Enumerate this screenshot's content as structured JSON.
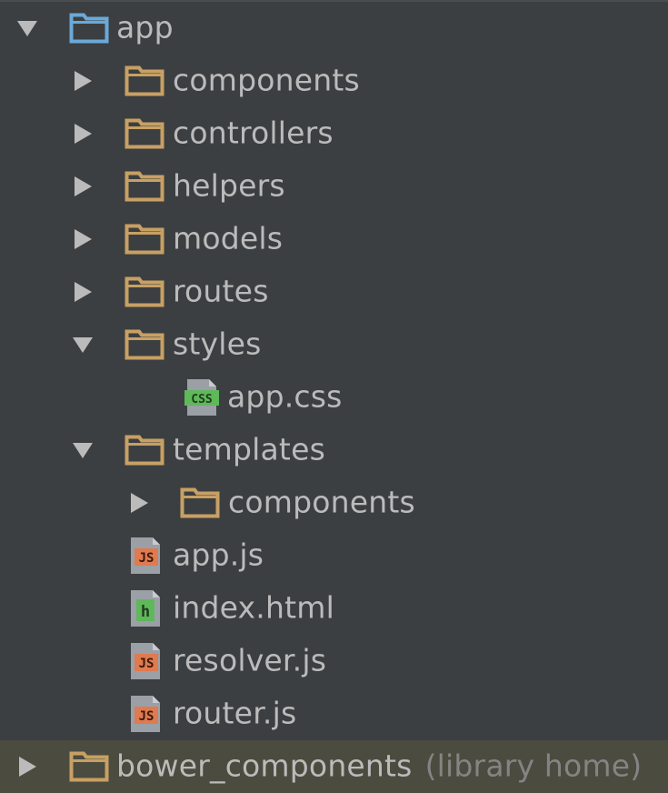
{
  "tree": {
    "root": {
      "label": "app"
    },
    "app_children": [
      {
        "label": "components"
      },
      {
        "label": "controllers"
      },
      {
        "label": "helpers"
      },
      {
        "label": "models"
      },
      {
        "label": "routes"
      },
      {
        "label": "styles"
      }
    ],
    "styles_children": [
      {
        "label": "app.css",
        "badge": "CSS"
      }
    ],
    "templates": {
      "label": "templates"
    },
    "templates_children": [
      {
        "label": "components"
      }
    ],
    "files": [
      {
        "label": "app.js",
        "badge": "JS"
      },
      {
        "label": "index.html",
        "badge": "h"
      },
      {
        "label": "resolver.js",
        "badge": "JS"
      },
      {
        "label": "router.js",
        "badge": "JS"
      }
    ],
    "bower": {
      "label": "bower_components",
      "hint": "(library home)"
    }
  },
  "colors": {
    "background": "#3c3f41",
    "text": "#bbbbbb",
    "folder": "#c8a064",
    "module_folder": "#6aa9d9",
    "js_badge": "#e07a4f",
    "css_badge": "#5fb85a",
    "html_badge": "#5fb85a"
  }
}
